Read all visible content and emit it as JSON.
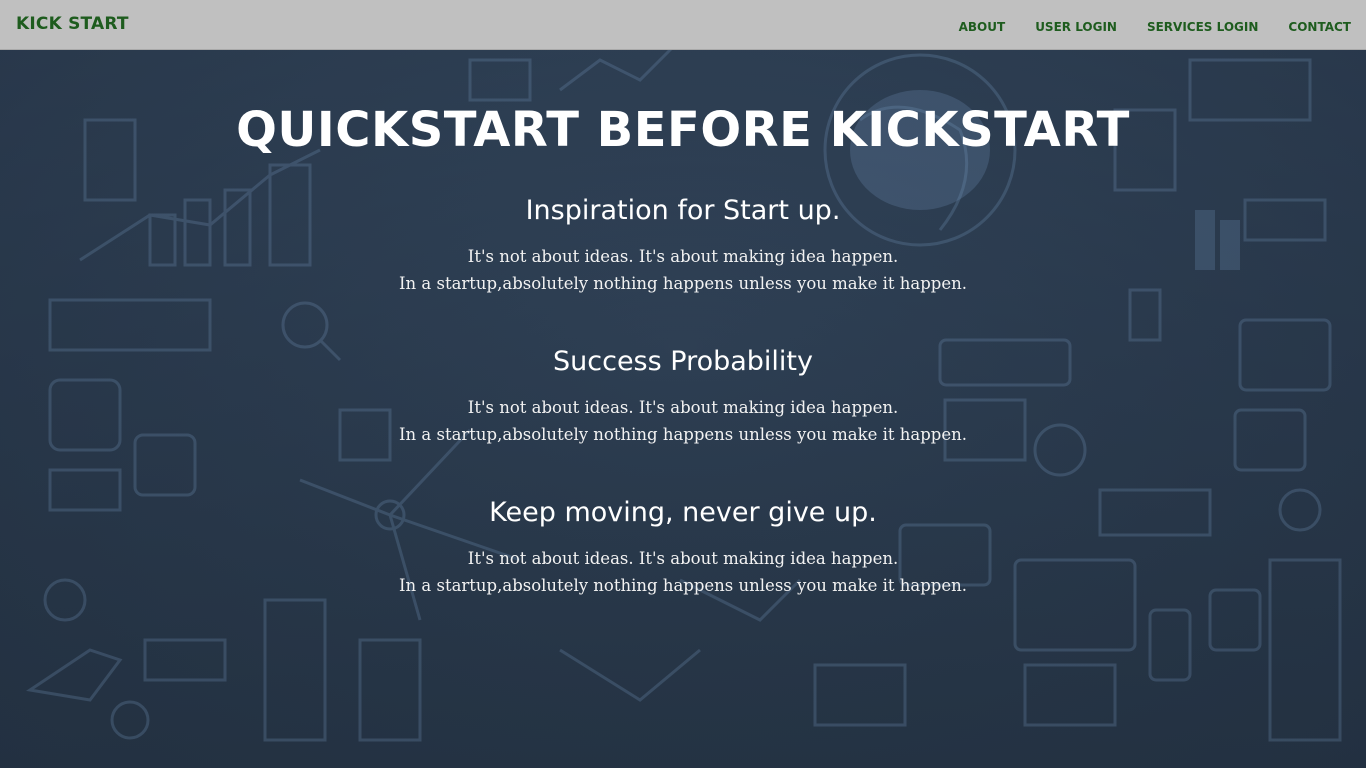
{
  "navbar": {
    "brand": "KICK START",
    "links": [
      {
        "label": "ABOUT"
      },
      {
        "label": "USER LOGIN"
      },
      {
        "label": "SERVICES LOGIN"
      },
      {
        "label": "CONTACT"
      }
    ],
    "background_color": "#c0c0c0",
    "text_color": "#1e5c1e"
  },
  "hero": {
    "title": "QUICKSTART BEFORE KICKSTART"
  },
  "sections": [
    {
      "heading": "Inspiration for Start up.",
      "line1": "It's not about ideas. It's about making idea happen.",
      "line2": "In a startup,absolutely nothing happens unless you make it happen."
    },
    {
      "heading": "Success Probability",
      "line1": "It's not about ideas. It's about making idea happen.",
      "line2": "In a startup,absolutely nothing happens unless you make it happen."
    },
    {
      "heading": "Keep moving, never give up.",
      "line1": "It's not about ideas. It's about making idea happen.",
      "line2": "In a startup,absolutely nothing happens unless you make it happen."
    }
  ],
  "theme": {
    "background_color": "#2c3b4d",
    "doodle_color": "#6f8fb3"
  }
}
